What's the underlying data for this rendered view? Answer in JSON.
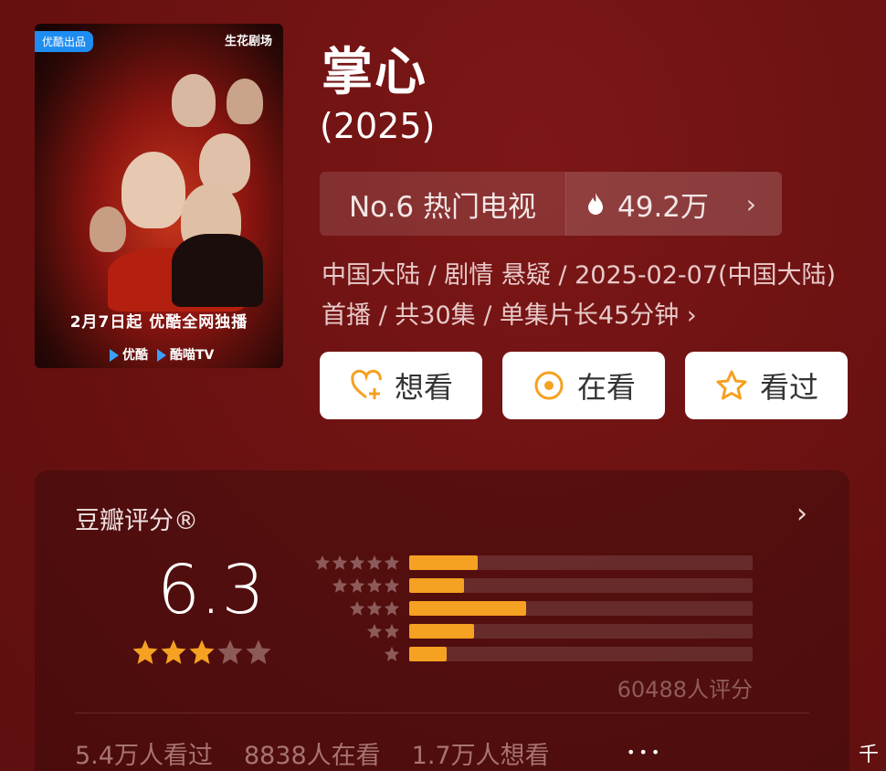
{
  "poster": {
    "badge": "优酷出品",
    "studio": "生花剧场",
    "caption": "2月7日起 优酷全网独播",
    "platform1": "优酷",
    "platform2": "酷喵TV"
  },
  "title": "掌心",
  "year": "(2025)",
  "rank": {
    "label": "No.6 热门电视",
    "heat": "49.2万",
    "chevron": "›"
  },
  "info": {
    "line": "中国大陆 / 剧情 悬疑 / 2025-02-07(中国大陆)首播 / 共30集 / 单集片长45分钟 ›"
  },
  "actions": {
    "want": "想看",
    "watching": "在看",
    "watched": "看过"
  },
  "rating": {
    "header": "豆瓣评分®",
    "chevron": "›",
    "score": "6.3",
    "score_stars_filled": 3,
    "score_stars_total": 5,
    "count_text": "60488人评分",
    "distribution": [
      {
        "stars": 5,
        "fraction": 0.2
      },
      {
        "stars": 4,
        "fraction": 0.16
      },
      {
        "stars": 3,
        "fraction": 0.34
      },
      {
        "stars": 2,
        "fraction": 0.19
      },
      {
        "stars": 1,
        "fraction": 0.11
      }
    ]
  },
  "stats": {
    "watched": "5.4万人看过",
    "watching": "8838人在看",
    "want": "1.7万人想看"
  },
  "footer": {
    "dots": "•••",
    "corner": "千"
  },
  "colors": {
    "background": "#6e1212",
    "bar_fill": "#f5a122",
    "star_filled": "#f5a122",
    "star_empty": "#8d5a5a"
  }
}
